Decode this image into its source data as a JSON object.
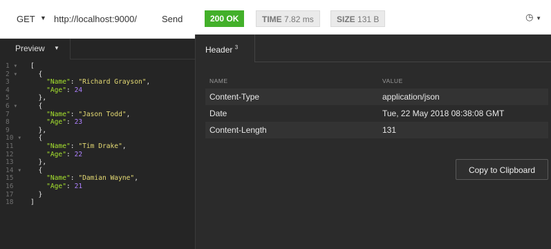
{
  "request": {
    "method": "GET",
    "url": "http://localhost:9000/",
    "send_label": "Send"
  },
  "response": {
    "status": "200 OK",
    "time_label": "TIME",
    "time_value": "7.82 ms",
    "size_label": "SIZE",
    "size_value": "131 B",
    "history_icon": "clock-icon"
  },
  "preview": {
    "label": "Preview",
    "lines": [
      {
        "n": "1",
        "fold": true
      },
      {
        "n": "2",
        "fold": true
      },
      {
        "n": "3"
      },
      {
        "n": "4"
      },
      {
        "n": "5"
      },
      {
        "n": "6",
        "fold": true
      },
      {
        "n": "7"
      },
      {
        "n": "8"
      },
      {
        "n": "9"
      },
      {
        "n": "10",
        "fold": true
      },
      {
        "n": "11"
      },
      {
        "n": "12"
      },
      {
        "n": "13"
      },
      {
        "n": "14",
        "fold": true
      },
      {
        "n": "15"
      },
      {
        "n": "16"
      },
      {
        "n": "17"
      },
      {
        "n": "18"
      }
    ],
    "people": [
      {
        "name": "Richard Grayson",
        "age": "24"
      },
      {
        "name": "Jason Todd",
        "age": "23"
      },
      {
        "name": "Tim Drake",
        "age": "22"
      },
      {
        "name": "Damian Wayne",
        "age": "21"
      }
    ],
    "key_name": "\"Name\"",
    "key_age": "\"Age\""
  },
  "headers_tab": {
    "label": "Header",
    "count": "3",
    "col_name": "NAME",
    "col_value": "VALUE",
    "rows": [
      {
        "name": "Content-Type",
        "value": "application/json"
      },
      {
        "name": "Date",
        "value": "Tue, 22 May 2018 08:38:08 GMT"
      },
      {
        "name": "Content-Length",
        "value": "131"
      }
    ],
    "copy_label": "Copy to Clipboard"
  },
  "colors": {
    "status_green": "#43b02a",
    "json_key": "#a6e22e",
    "json_string": "#e6db74",
    "json_number": "#ae81ff"
  }
}
